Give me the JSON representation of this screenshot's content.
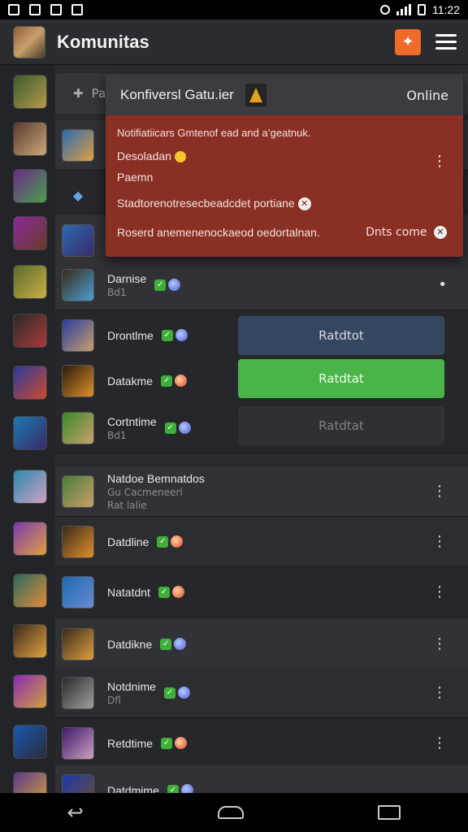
{
  "status_bar": {
    "time": "11:22"
  },
  "app_bar": {
    "title": "Komunitas",
    "action_icon": "puzzle-icon",
    "menu_icon": "hamburger-menu-icon"
  },
  "search": {
    "placeholder": "Pa"
  },
  "popup": {
    "title": "Konfiversl Gatu.ier",
    "status": "Online",
    "line1": "Notifiatiicars Gmtenof ead and a’geatnuk.",
    "line2": "Desoladan",
    "line3": "Paemn",
    "line4": "Stadtorenotresecbeadcdet portiane",
    "line5": "Roserd anemenenockaeod oedortalnan.",
    "action": "Dnts come"
  },
  "rows": [
    {
      "name": "Darnise",
      "sub": "Bd1",
      "globe": "blue"
    },
    {
      "name": "Drontlme",
      "sub": "",
      "globe": "blue",
      "button": "Ratdtot",
      "button_style": "blue"
    },
    {
      "name": "Datakme",
      "sub": "",
      "globe": "red",
      "button": "Ratdtat",
      "button_style": "green"
    },
    {
      "name": "Cortntime",
      "sub": "Bd1",
      "globe": "blue",
      "button": "Ratdtat",
      "button_style": "dark"
    },
    {
      "name": "Natdoe Bemnatdos",
      "sub": "Gu Cacmeneerl",
      "sub2": "Rat lalie"
    },
    {
      "name": "Datdline",
      "globe": "red"
    },
    {
      "name": "Natatdnt",
      "globe": "red"
    },
    {
      "name": "Datdikne",
      "globe": "blue"
    },
    {
      "name": "Notdnime",
      "sub": "Dfl",
      "globe": "blue"
    },
    {
      "name": "Retdtime",
      "globe": "red"
    },
    {
      "name": "Datdmime",
      "globe": "blue"
    }
  ],
  "colors": {
    "accent": "#f06a2a",
    "green": "#49b548",
    "popup": "#8a2f24"
  }
}
